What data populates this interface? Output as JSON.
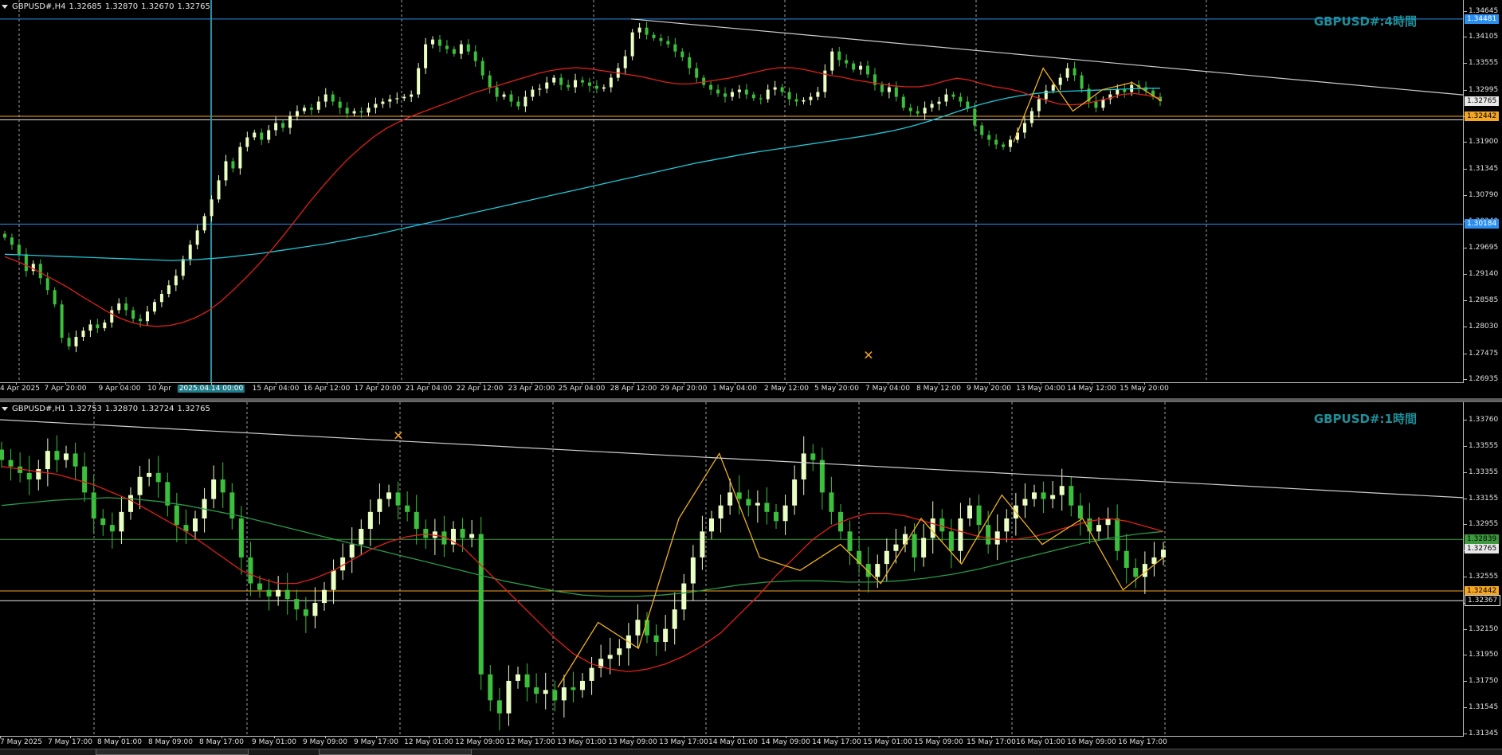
{
  "colors": {
    "background": "#000000",
    "bull_candle": "#eaffc4",
    "bear_candle": "#3cbf3c",
    "ma_fast": "#e0201a",
    "ma_slow_h4": "#1ec8d8",
    "ma_slow_h1": "#2a9a4a",
    "zigzag": "#f0b020",
    "trendline": "#cfcfcf",
    "hline_blue": "#2b8ff0",
    "hline_orange": "#f5a623",
    "hline_green": "#3c9a3c",
    "hline_white": "#e8e8e8",
    "grid": "#c8c8c8",
    "watermark": "#1e8f9a"
  },
  "h4": {
    "header": {
      "symbol": "GBPUSD#,H4",
      "open": "1.32685",
      "high": "1.32870",
      "low": "1.32670",
      "close": "1.32765"
    },
    "watermark": "GBPUSD#:4時間",
    "y_ticks": [
      "1.34645",
      "1.34105",
      "1.33555",
      "1.32995",
      "1.32450",
      "1.31900",
      "1.31345",
      "1.30790",
      "1.30240",
      "1.29695",
      "1.29140",
      "1.28585",
      "1.28030",
      "1.27475",
      "1.26935"
    ],
    "y_range": [
      1.26935,
      1.34645
    ],
    "price_tags": [
      {
        "label": "1.34481",
        "price": 1.34481,
        "bg": "#2b8ff0",
        "fg": "#ffffff"
      },
      {
        "label": "1.32765",
        "price": 1.32765,
        "bg": "#e8e8e8",
        "fg": "#000000"
      },
      {
        "label": "1.32442",
        "price": 1.32442,
        "bg": "#f5a623",
        "fg": "#000000"
      },
      {
        "label": "1.30184",
        "price": 1.30184,
        "bg": "#2b8ff0",
        "fg": "#ffffff"
      }
    ],
    "hlines": [
      {
        "price": 1.34481,
        "color": "blue"
      },
      {
        "price": 1.32442,
        "color": "orange"
      },
      {
        "price": 1.3237,
        "color": "white"
      },
      {
        "price": 1.30184,
        "color": "blue"
      }
    ],
    "x_labels": [
      "4 Apr 2025",
      "7 Apr 20:00",
      "9 Apr 04:00",
      "10 Apr",
      "2025.04.14 00:00",
      "15 Apr 04:00",
      "16 Apr 12:00",
      "17 Apr 20:00",
      "21 Apr 04:00",
      "22 Apr 12:00",
      "23 Apr 20:00",
      "25 Apr 04:00",
      "28 Apr 12:00",
      "29 Apr 20:00",
      "1 May 04:00",
      "2 May 12:00",
      "5 May 20:00",
      "7 May 04:00",
      "8 May 12:00",
      "9 May 20:00",
      "13 May 04:00",
      "14 May 12:00",
      "15 May 20:00"
    ],
    "x_highlight": "2025.04.14 00:00",
    "crosshair_label": "2025.04.14 00:00",
    "closes": [
      1.299,
      1.2975,
      1.2955,
      1.292,
      1.2935,
      1.2905,
      1.288,
      1.285,
      1.278,
      1.2762,
      1.2782,
      1.2795,
      1.2808,
      1.28,
      1.2812,
      1.2838,
      1.2852,
      1.2838,
      1.282,
      1.2815,
      1.2835,
      1.2855,
      1.2872,
      1.289,
      1.291,
      1.2945,
      1.2975,
      1.3005,
      1.3035,
      1.307,
      1.311,
      1.315,
      1.3135,
      1.318,
      1.32,
      1.321,
      1.3195,
      1.3215,
      1.323,
      1.322,
      1.3245,
      1.3255,
      1.3262,
      1.3258,
      1.3275,
      1.329,
      1.3275,
      1.3262,
      1.325,
      1.3255,
      1.3252,
      1.3262,
      1.327,
      1.3275,
      1.328,
      1.3282,
      1.3285,
      1.329,
      1.3345,
      1.3395,
      1.3405,
      1.3392,
      1.3385,
      1.3375,
      1.3395,
      1.338,
      1.336,
      1.333,
      1.3305,
      1.3285,
      1.329,
      1.3275,
      1.3265,
      1.3285,
      1.33,
      1.3302,
      1.3315,
      1.3325,
      1.331,
      1.3305,
      1.332,
      1.3315,
      1.3308,
      1.3302,
      1.3305,
      1.3325,
      1.3345,
      1.337,
      1.342,
      1.343,
      1.3415,
      1.3408,
      1.3402,
      1.3395,
      1.338,
      1.3368,
      1.3345,
      1.3325,
      1.331,
      1.33,
      1.3292,
      1.3285,
      1.3295,
      1.33,
      1.329,
      1.3282,
      1.328,
      1.33,
      1.3305,
      1.3295,
      1.328,
      1.3275,
      1.3278,
      1.3285,
      1.3295,
      1.334,
      1.338,
      1.3362,
      1.3355,
      1.3342,
      1.335,
      1.3332,
      1.331,
      1.3295,
      1.3305,
      1.3285,
      1.3262,
      1.3255,
      1.325,
      1.3262,
      1.327,
      1.3275,
      1.329,
      1.3285,
      1.3275,
      1.326,
      1.3225,
      1.3205,
      1.3195,
      1.3185,
      1.318,
      1.3195,
      1.321,
      1.323,
      1.3255,
      1.328,
      1.3298,
      1.331,
      1.3325,
      1.3345,
      1.333,
      1.3302,
      1.3275,
      1.3262,
      1.328,
      1.329,
      1.33,
      1.3295,
      1.331,
      1.3305,
      1.3298,
      1.3285,
      1.3276
    ],
    "ma_fast": [
      1.295,
      1.294,
      1.2928,
      1.2914,
      1.29,
      1.2885,
      1.2868,
      1.2852,
      1.2836,
      1.2822,
      1.2812,
      1.2806,
      1.2804,
      1.2806,
      1.2812,
      1.2822,
      1.2836,
      1.2856,
      1.288,
      1.2906,
      1.2934,
      1.2964,
      1.2996,
      1.303,
      1.3064,
      1.3096,
      1.3126,
      1.3154,
      1.3178,
      1.32,
      1.3218,
      1.3232,
      1.3244,
      1.3254,
      1.3264,
      1.3274,
      1.3284,
      1.3294,
      1.3302,
      1.331,
      1.3318,
      1.3326,
      1.3334,
      1.334,
      1.3344,
      1.3346,
      1.3344,
      1.334,
      1.3336,
      1.3332,
      1.3328,
      1.3322,
      1.3316,
      1.3312,
      1.3312,
      1.3316,
      1.332,
      1.3324,
      1.333,
      1.3336,
      1.3342,
      1.3346,
      1.3346,
      1.3342,
      1.3336,
      1.333,
      1.3326,
      1.332,
      1.3316,
      1.3312,
      1.3308,
      1.3306,
      1.3306,
      1.331,
      1.3318,
      1.3324,
      1.332,
      1.3312,
      1.3306,
      1.3302,
      1.3296,
      1.3286,
      1.3278,
      1.327,
      1.3268,
      1.327,
      1.3276,
      1.3282,
      1.329,
      1.3292,
      1.3288,
      1.3282
    ],
    "ma_slow": [
      1.2955,
      1.2954,
      1.2953,
      1.2952,
      1.2951,
      1.295,
      1.2949,
      1.2948,
      1.2947,
      1.2946,
      1.2945,
      1.2944,
      1.2943,
      1.2942,
      1.2943,
      1.2944,
      1.2946,
      1.2948,
      1.2951,
      1.2954,
      1.2957,
      1.2961,
      1.2965,
      1.2969,
      1.2973,
      1.2977,
      1.2982,
      1.2987,
      1.2992,
      1.2997,
      1.3003,
      1.3009,
      1.3015,
      1.3021,
      1.3027,
      1.3033,
      1.3039,
      1.3045,
      1.3051,
      1.3057,
      1.3063,
      1.3069,
      1.3075,
      1.3081,
      1.3087,
      1.3093,
      1.3099,
      1.3105,
      1.3111,
      1.3117,
      1.3123,
      1.3129,
      1.3135,
      1.3141,
      1.3147,
      1.3152,
      1.3157,
      1.3162,
      1.3167,
      1.3171,
      1.3175,
      1.3179,
      1.3183,
      1.3187,
      1.3191,
      1.3195,
      1.3199,
      1.3203,
      1.3208,
      1.3213,
      1.3219,
      1.3226,
      1.3234,
      1.3243,
      1.3252,
      1.3261,
      1.3269,
      1.3276,
      1.3282,
      1.3287,
      1.3291,
      1.3294,
      1.3296,
      1.3297,
      1.3298,
      1.3299,
      1.33,
      1.3301,
      1.3302,
      1.3303,
      1.3303
    ]
  },
  "h1": {
    "header": {
      "symbol": "GBPUSD#,H1",
      "open": "1.32753",
      "high": "1.32870",
      "low": "1.32724",
      "close": "1.32765"
    },
    "watermark": "GBPUSD#:1時間",
    "y_ticks": [
      "1.33760",
      "1.33555",
      "1.33355",
      "1.33155",
      "1.32955",
      "1.32755",
      "1.32555",
      "1.32350",
      "1.32150",
      "1.31950",
      "1.31750",
      "1.31545",
      "1.31345"
    ],
    "y_range": [
      1.31345,
      1.3376
    ],
    "price_tags": [
      {
        "label": "1.32839",
        "price": 1.32839,
        "bg": "#3c9a3c",
        "fg": "#000000"
      },
      {
        "label": "1.32765",
        "price": 1.32765,
        "bg": "#e8e8e8",
        "fg": "#000000"
      },
      {
        "label": "1.32442",
        "price": 1.32442,
        "bg": "#f5a623",
        "fg": "#000000"
      },
      {
        "label": "1.32367",
        "price": 1.32367,
        "bg": "#000000",
        "fg": "#e8e8e8"
      }
    ],
    "hlines": [
      {
        "price": 1.32839,
        "color": "green"
      },
      {
        "price": 1.32442,
        "color": "orange"
      },
      {
        "price": 1.32367,
        "color": "white"
      }
    ],
    "x_labels": [
      "7 May 2025",
      "7 May 17:00",
      "8 May 01:00",
      "8 May 09:00",
      "8 May 17:00",
      "9 May 01:00",
      "9 May 09:00",
      "9 May 17:00",
      "12 May 01:00",
      "12 May 09:00",
      "12 May 17:00",
      "13 May 01:00",
      "13 May 09:00",
      "13 May 17:00",
      "14 May 01:00",
      "14 May 09:00",
      "14 May 17:00",
      "15 May 01:00",
      "15 May 09:00",
      "15 May 17:00",
      "16 May 01:00",
      "16 May 09:00",
      "16 May 17:00"
    ],
    "closes": [
      1.3345,
      1.334,
      1.3335,
      1.333,
      1.3338,
      1.3352,
      1.3345,
      1.335,
      1.334,
      1.332,
      1.33,
      1.3295,
      1.329,
      1.3305,
      1.3318,
      1.3332,
      1.3335,
      1.3328,
      1.331,
      1.3295,
      1.329,
      1.33,
      1.3315,
      1.333,
      1.332,
      1.33,
      1.327,
      1.325,
      1.3245,
      1.324,
      1.3245,
      1.3238,
      1.323,
      1.3225,
      1.3235,
      1.3245,
      1.326,
      1.327,
      1.328,
      1.3292,
      1.3305,
      1.3315,
      1.332,
      1.331,
      1.3305,
      1.3292,
      1.3285,
      1.329,
      1.328,
      1.3292,
      1.3285,
      1.3288,
      1.318,
      1.316,
      1.315,
      1.3175,
      1.318,
      1.317,
      1.3165,
      1.3168,
      1.316,
      1.317,
      1.3168,
      1.3175,
      1.3185,
      1.3192,
      1.3195,
      1.32,
      1.321,
      1.3222,
      1.321,
      1.3205,
      1.3215,
      1.323,
      1.325,
      1.327,
      1.329,
      1.33,
      1.331,
      1.332,
      1.3315,
      1.331,
      1.3312,
      1.3305,
      1.3298,
      1.331,
      1.333,
      1.335,
      1.3345,
      1.332,
      1.3305,
      1.329,
      1.3275,
      1.3265,
      1.3255,
      1.3265,
      1.3275,
      1.328,
      1.3288,
      1.327,
      1.3285,
      1.33,
      1.329,
      1.3275,
      1.33,
      1.331,
      1.3295,
      1.328,
      1.329,
      1.33,
      1.331,
      1.3315,
      1.332,
      1.3315,
      1.3318,
      1.3325,
      1.331,
      1.33,
      1.329,
      1.3295,
      1.33,
      1.3275,
      1.3262,
      1.3255,
      1.3265,
      1.327,
      1.3276
    ],
    "ma_fast": [
      1.334,
      1.3338,
      1.3336,
      1.3334,
      1.333,
      1.3326,
      1.332,
      1.3314,
      1.3306,
      1.3298,
      1.329,
      1.328,
      1.327,
      1.326,
      1.3254,
      1.325,
      1.325,
      1.3254,
      1.326,
      1.3268,
      1.3276,
      1.3282,
      1.3286,
      1.3288,
      1.3286,
      1.3278,
      1.3264,
      1.325,
      1.3236,
      1.3222,
      1.3208,
      1.3196,
      1.3188,
      1.3184,
      1.3182,
      1.3184,
      1.3188,
      1.3194,
      1.3202,
      1.3212,
      1.3226,
      1.324,
      1.3256,
      1.327,
      1.3284,
      1.3294,
      1.33,
      1.3304,
      1.3304,
      1.3302,
      1.3298,
      1.3294,
      1.329,
      1.3286,
      1.3284,
      1.3284,
      1.3286,
      1.329,
      1.3294,
      1.3298,
      1.33,
      1.3298,
      1.3294,
      1.329
    ],
    "ma_slow": [
      1.331,
      1.3312,
      1.3314,
      1.3315,
      1.3316,
      1.3315,
      1.3313,
      1.331,
      1.3306,
      1.3302,
      1.3297,
      1.3292,
      1.3287,
      1.3282,
      1.3277,
      1.3272,
      1.3267,
      1.3262,
      1.3257,
      1.3252,
      1.3248,
      1.3244,
      1.3241,
      1.324,
      1.324,
      1.3241,
      1.3243,
      1.3246,
      1.3249,
      1.3251,
      1.3252,
      1.3252,
      1.3251,
      1.3251,
      1.3252,
      1.3254,
      1.3257,
      1.3261,
      1.3266,
      1.3271,
      1.3276,
      1.3281,
      1.3285,
      1.3288,
      1.329
    ],
    "trend_start": 1.3376,
    "trend_end": 1.3316
  },
  "h4_trend": {
    "start": 1.34481,
    "end": 1.3289
  },
  "h4_zigzag": [
    1.319,
    1.3345,
    1.3255,
    1.33,
    1.3315,
    1.3276
  ],
  "h1_zigzag": [
    1.317,
    1.322,
    1.32,
    1.33,
    1.335,
    1.327,
    1.326,
    1.328,
    1.325,
    1.33,
    1.3265,
    1.3318,
    1.328,
    1.33,
    1.3245,
    1.327
  ]
}
